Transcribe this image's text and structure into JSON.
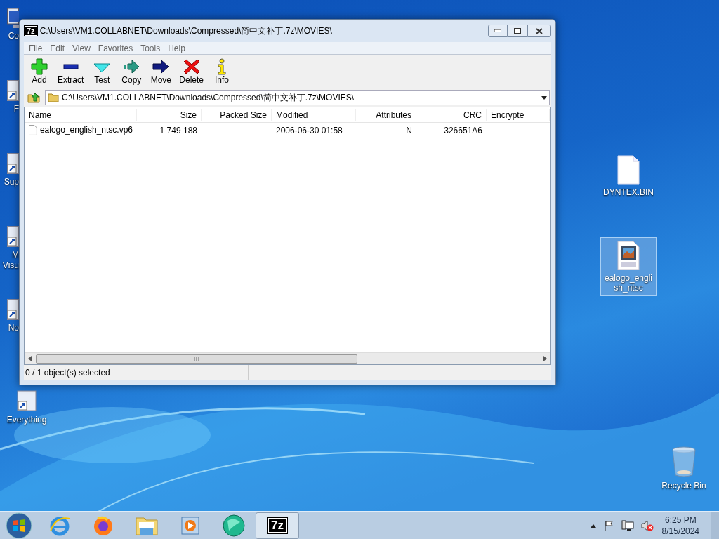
{
  "desktop": {
    "left": [
      {
        "label": "Co",
        "kind": "computer"
      },
      {
        "label": "F",
        "kind": "shortcut"
      },
      {
        "label": "Sup",
        "kind": "shortcut"
      },
      {
        "label": "M Visu",
        "kind": "shortcut"
      },
      {
        "label": "No",
        "kind": "shortcut"
      }
    ],
    "below": {
      "label": "Everything",
      "kind": "shortcut",
      "selected": false
    },
    "right": [
      {
        "label": "DYNTEX.BIN",
        "kind": "file",
        "selected": false
      },
      {
        "label": "ealogo_english_ntsc",
        "kind": "video",
        "selected": true
      }
    ],
    "corner": {
      "label": "Recycle Bin",
      "kind": "recycle",
      "selected": false
    }
  },
  "window": {
    "logo": "7z",
    "title": "C:\\Users\\VM1.COLLABNET\\Downloads\\Compressed\\简中文补丁.7z\\MOVIES\\",
    "menu": [
      "File",
      "Edit",
      "View",
      "Favorites",
      "Tools",
      "Help"
    ],
    "toolbar": [
      {
        "label": "Add",
        "kind": "add"
      },
      {
        "label": "Extract",
        "kind": "extract"
      },
      {
        "label": "Test",
        "kind": "test"
      },
      {
        "label": "Copy",
        "kind": "copy"
      },
      {
        "label": "Move",
        "kind": "move"
      },
      {
        "label": "Delete",
        "kind": "delete"
      },
      {
        "label": "Info",
        "kind": "info"
      }
    ],
    "address": "C:\\Users\\VM1.COLLABNET\\Downloads\\Compressed\\简中文补丁.7z\\MOVIES\\",
    "table": {
      "columns": [
        "Name",
        "Size",
        "Packed Size",
        "Modified",
        "Attributes",
        "CRC",
        "Encrypte"
      ],
      "rows": [
        {
          "name": "ealogo_english_ntsc.vp6",
          "size": "1 749 188",
          "modified": "2006-06-30 01:58",
          "attributes": "N",
          "crc": "326651A6",
          "selected": false
        }
      ]
    },
    "status_bar": "0 / 1 object(s) selected"
  },
  "taskbar": {
    "items": [
      {
        "kind": "start",
        "selected": false
      },
      {
        "kind": "ie",
        "selected": false
      },
      {
        "kind": "firefox",
        "selected": false
      },
      {
        "kind": "explorer",
        "selected": false
      },
      {
        "kind": "media",
        "selected": false
      },
      {
        "kind": "globe",
        "selected": false
      },
      {
        "kind": "sevenzip",
        "label": "7z",
        "selected": true
      }
    ],
    "tray": [
      {
        "kind": "chevron"
      },
      {
        "kind": "flag"
      },
      {
        "kind": "network"
      },
      {
        "kind": "volume-muted"
      }
    ],
    "time": "6:25 PM",
    "date": "8/15/2024"
  }
}
